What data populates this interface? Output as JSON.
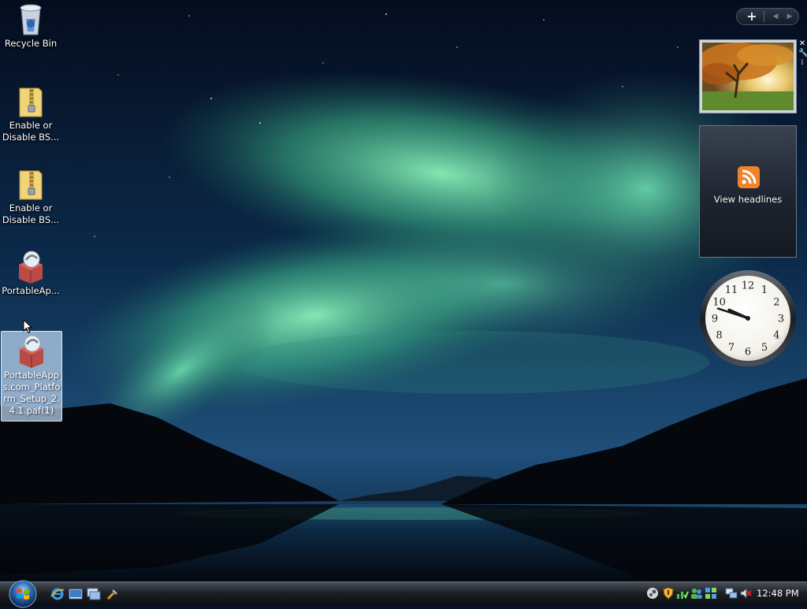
{
  "desktop": {
    "icons": [
      {
        "label": "Recycle Bin",
        "icon": "recycle-bin-icon"
      },
      {
        "label": "Enable or Disable BS...",
        "icon": "zip-folder-icon"
      },
      {
        "label": "Enable or Disable BS...",
        "icon": "zip-folder-icon"
      },
      {
        "label": "PortableAp...",
        "icon": "portableapps-installer-icon"
      },
      {
        "label": "PortableApps.com_Platform_Setup_2.4.1.paf(1)",
        "icon": "portableapps-installer-icon",
        "selected": true
      }
    ]
  },
  "sidebar": {
    "controls": {
      "add_label": "+",
      "prev_icon": "prev-arrow-icon",
      "next_icon": "next-arrow-icon"
    },
    "gadgets": {
      "slideshow": {
        "icon": "autumn-tree-photo"
      },
      "feed": {
        "text": "View headlines",
        "icon": "rss-feed-icon"
      },
      "clock": {
        "hour": 9,
        "minute": 48,
        "numbers": [
          "12",
          "1",
          "2",
          "3",
          "4",
          "5",
          "6",
          "7",
          "8",
          "9",
          "10",
          "11"
        ]
      }
    },
    "tools": {
      "close": "✕",
      "settings_icon": "wrench-icon",
      "drag_icon": "grip-icon"
    }
  },
  "taskbar": {
    "start_icon": "windows-orb-icon",
    "quick_launch": [
      {
        "name": "internet-explorer-icon"
      },
      {
        "name": "show-desktop-icon"
      },
      {
        "name": "switch-windows-icon"
      },
      {
        "name": "tool-icon"
      }
    ],
    "tray": {
      "icons": [
        "steam-icon",
        "security-shield-icon",
        "network-green-icon",
        "people-icon",
        "network-grid-icon",
        "network-connection-icon",
        "volume-muted-icon"
      ],
      "time": "12:48 PM"
    }
  },
  "colors": {
    "accent_green": "#4fd49a",
    "feed_orange": "#f0832a"
  }
}
